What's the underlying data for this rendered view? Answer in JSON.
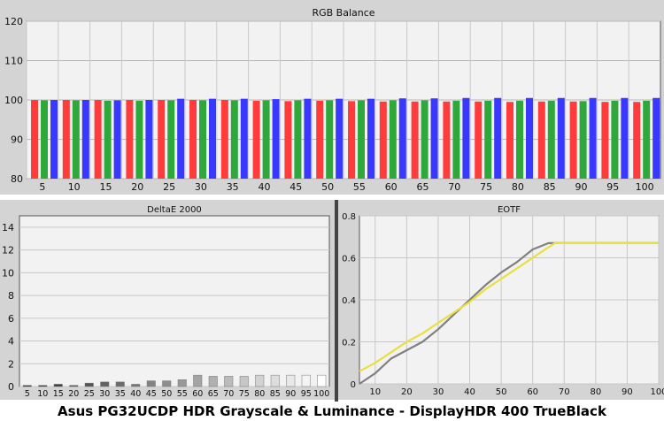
{
  "footer_title": "Asus PG32UCDP HDR Grayscale & Luminance - DisplayHDR 400 TrueBlack",
  "colors": {
    "panel_bg": "#d4d4d4",
    "plot_bg": "#f2f2f2",
    "red": "#ff3b3b",
    "green": "#2ea83a",
    "blue": "#3838ff",
    "target": "#808080",
    "measured": "#e8e040"
  },
  "chart_data": [
    {
      "type": "bar",
      "title": "RGB Balance",
      "ylim": [
        80,
        120
      ],
      "yticks": [
        80,
        90,
        100,
        110,
        120
      ],
      "grid": true,
      "categories": [
        "5",
        "10",
        "15",
        "20",
        "25",
        "30",
        "35",
        "40",
        "45",
        "50",
        "55",
        "60",
        "65",
        "70",
        "75",
        "80",
        "85",
        "90",
        "95",
        "100"
      ],
      "series": [
        {
          "color": "red",
          "values": [
            100,
            100,
            100,
            100,
            100,
            100,
            100,
            99.8,
            99.7,
            99.8,
            99.7,
            99.6,
            99.6,
            99.6,
            99.6,
            99.5,
            99.6,
            99.6,
            99.5,
            99.5
          ]
        },
        {
          "color": "green",
          "values": [
            99.9,
            99.9,
            99.8,
            99.8,
            99.9,
            99.9,
            99.9,
            99.9,
            99.9,
            99.9,
            99.9,
            99.9,
            99.9,
            99.8,
            99.8,
            99.8,
            99.8,
            99.7,
            99.8,
            99.8
          ]
        },
        {
          "color": "blue",
          "values": [
            100,
            100,
            99.9,
            100,
            100.3,
            100.3,
            100.3,
            100.2,
            100.3,
            100.3,
            100.3,
            100.4,
            100.4,
            100.5,
            100.5,
            100.5,
            100.5,
            100.5,
            100.5,
            100.5
          ]
        }
      ]
    },
    {
      "type": "bar",
      "title": "DeltaE 2000",
      "ylim": [
        0,
        15
      ],
      "yticks": [
        0,
        2,
        4,
        6,
        8,
        10,
        12,
        14
      ],
      "grid": true,
      "categories": [
        "5",
        "10",
        "15",
        "20",
        "25",
        "30",
        "35",
        "40",
        "45",
        "50",
        "55",
        "60",
        "65",
        "70",
        "75",
        "80",
        "85",
        "90",
        "95",
        "100"
      ],
      "values": [
        0.1,
        0.1,
        0.2,
        0.1,
        0.3,
        0.4,
        0.4,
        0.2,
        0.5,
        0.5,
        0.6,
        1.0,
        0.9,
        0.9,
        0.9,
        1.0,
        1.0,
        1.0,
        1.0,
        1.0
      ]
    },
    {
      "type": "line",
      "title": "EOTF",
      "xlim": [
        5,
        100
      ],
      "ylim": [
        0,
        0.8
      ],
      "xticks": [
        10,
        20,
        30,
        40,
        50,
        60,
        70,
        80,
        90,
        100
      ],
      "yticks": [
        0,
        0.2,
        0.4,
        0.6,
        0.8
      ],
      "grid": true,
      "series": [
        {
          "color": "target",
          "x": [
            5,
            10,
            15,
            20,
            25,
            30,
            35,
            40,
            45,
            50,
            55,
            60,
            65,
            70,
            75,
            80,
            85,
            90,
            95,
            100
          ],
          "y": [
            0.0,
            0.05,
            0.12,
            0.16,
            0.2,
            0.26,
            0.33,
            0.4,
            0.47,
            0.53,
            0.58,
            0.64,
            0.67,
            0.67,
            0.67,
            0.67,
            0.67,
            0.67,
            0.67,
            0.67
          ]
        },
        {
          "color": "measured",
          "x": [
            5,
            10,
            15,
            20,
            25,
            30,
            35,
            40,
            45,
            50,
            55,
            60,
            65,
            67,
            70,
            75,
            80,
            85,
            90,
            95,
            100
          ],
          "y": [
            0.06,
            0.1,
            0.15,
            0.2,
            0.24,
            0.29,
            0.34,
            0.39,
            0.45,
            0.5,
            0.55,
            0.6,
            0.65,
            0.67,
            0.67,
            0.67,
            0.67,
            0.67,
            0.67,
            0.67,
            0.67
          ]
        }
      ]
    }
  ]
}
